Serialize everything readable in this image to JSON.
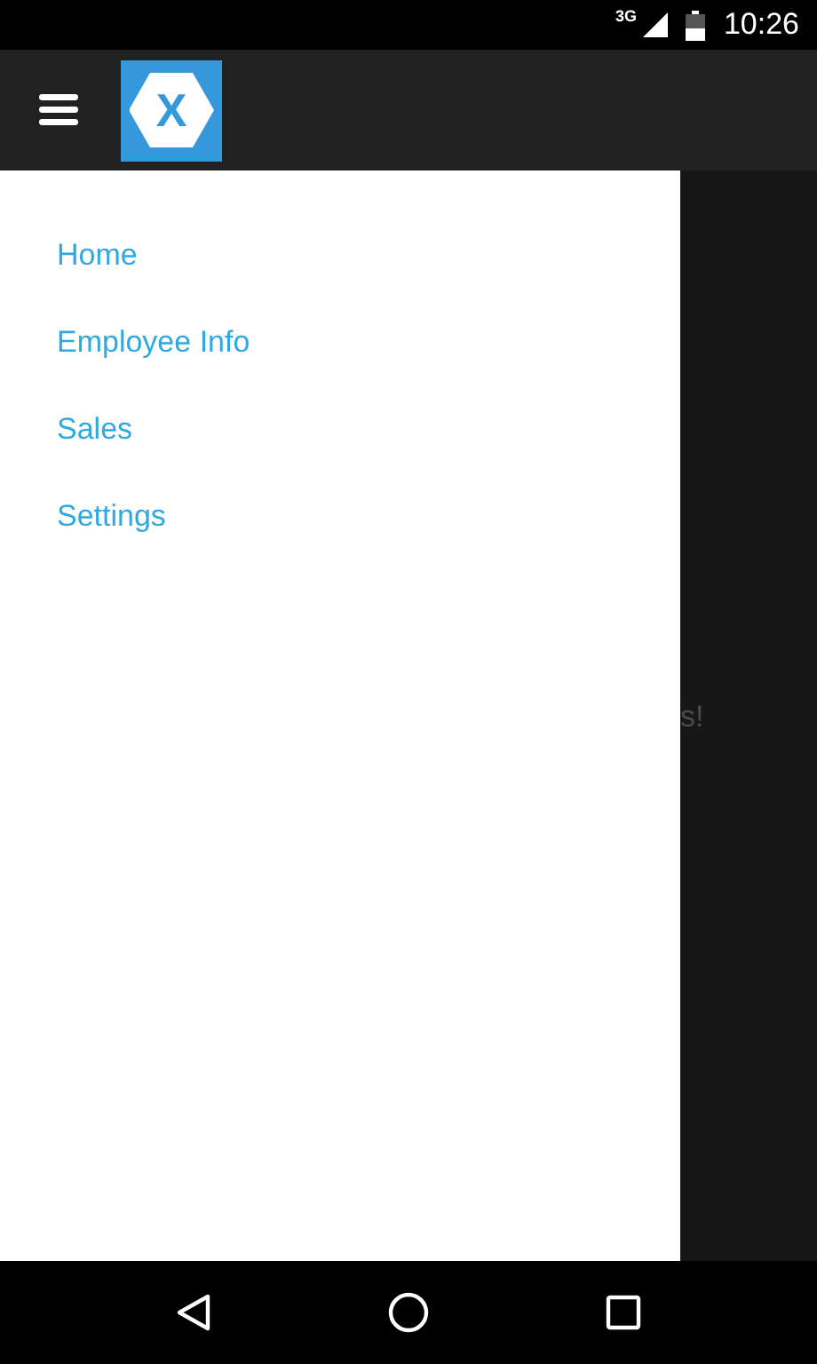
{
  "status_bar": {
    "network": "3G",
    "time": "10:26"
  },
  "toolbar": {
    "logo_mark": "X"
  },
  "drawer": {
    "items": [
      {
        "label": "Home"
      },
      {
        "label": "Employee Info"
      },
      {
        "label": "Sales"
      },
      {
        "label": "Settings"
      }
    ]
  },
  "content": {
    "text": "s!"
  }
}
